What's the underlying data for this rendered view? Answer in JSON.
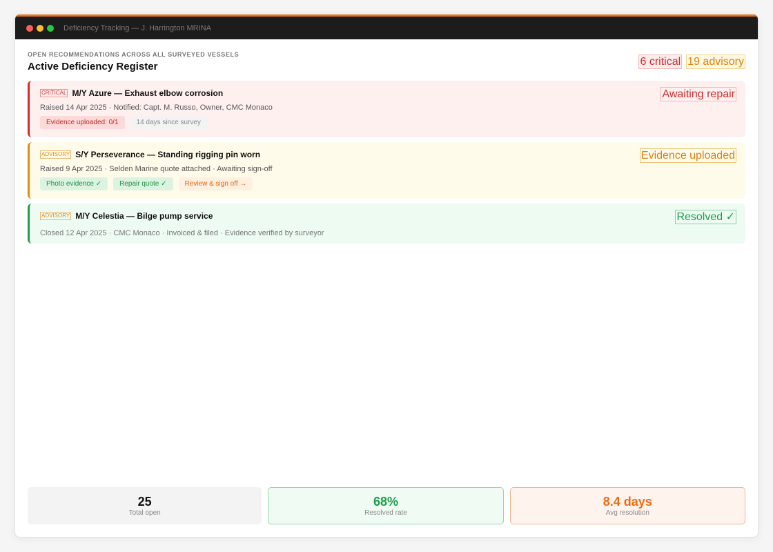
{
  "window": {
    "title": "Deficiency Tracking — J. Harrington MRINA"
  },
  "header": {
    "eyebrow": "Open recommendations across all surveyed vessels",
    "title": "Active Deficiency Register",
    "critical_count": "6 critical",
    "advisory_count": "19 advisory"
  },
  "cards": [
    {
      "tag": "Critical",
      "title": "M/Y Azure — Exhaust elbow corrosion",
      "status": "Awaiting repair",
      "meta": "Raised 14 Apr 2025 · Notified: Capt. M. Russo, Owner, CMC Monaco",
      "chips": [
        "Evidence uploaded: 0/1",
        "14 days since survey"
      ]
    },
    {
      "tag": "Advisory",
      "title": "S/Y Perseverance — Standing rigging pin worn",
      "status": "Evidence uploaded",
      "meta": "Raised 9 Apr 2025 · Selden Marine quote attached · Awaiting sign-off",
      "chips": [
        "Photo evidence ✓",
        "Repair quote ✓",
        "Review & sign off →"
      ]
    },
    {
      "tag": "Advisory",
      "title": "M/Y Celestia — Bilge pump service",
      "status": "Resolved ✓",
      "meta": "Closed 12 Apr 2025 · CMC Monaco · Invoiced & filed · Evidence verified by surveyor"
    }
  ],
  "stats": [
    {
      "value": "25",
      "label": "Total open"
    },
    {
      "value": "68%",
      "label": "Resolved rate"
    },
    {
      "value": "8.4 days",
      "label": "Avg resolution"
    }
  ],
  "colors": {
    "accent": "#f07318",
    "critical": "#d42a2a",
    "advisory": "#e08a17",
    "resolved": "#1f9d4d"
  }
}
